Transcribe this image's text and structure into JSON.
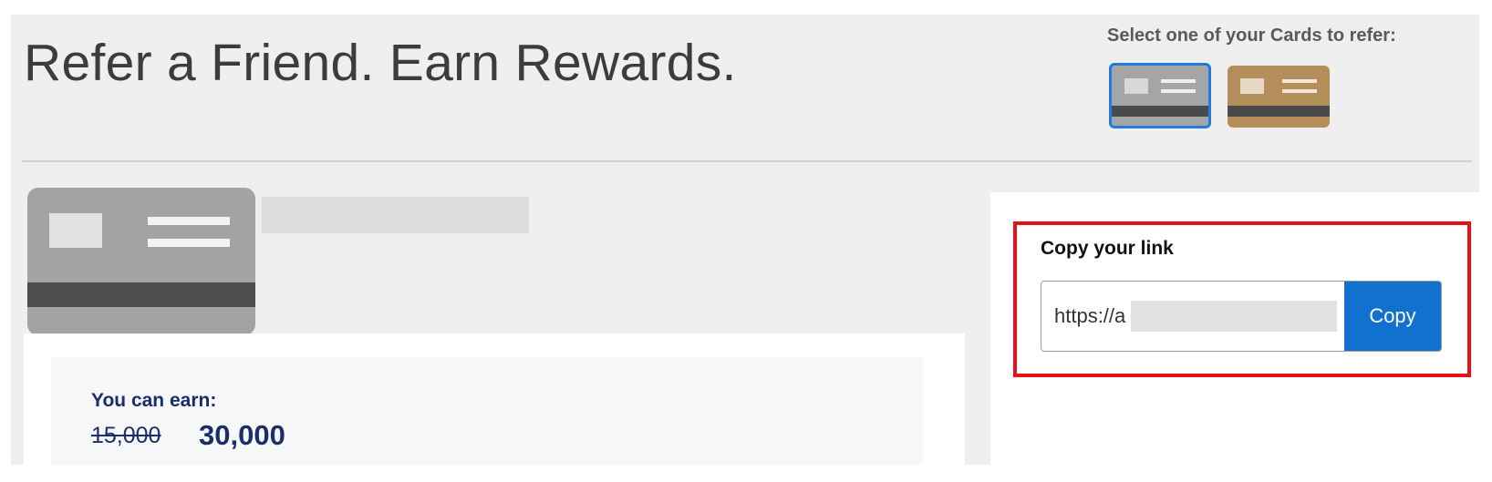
{
  "header": {
    "title": "Refer a Friend. Earn Rewards.",
    "select_label": "Select one of your Cards to refer:"
  },
  "cards": [
    {
      "name": "gray-card",
      "color": "#a5a5a7",
      "selected": true
    },
    {
      "name": "gold-card",
      "color": "#b48e5b",
      "selected": false
    }
  ],
  "offer": {
    "label": "You can earn:",
    "old_amount": "15,000",
    "new_amount": "30,000"
  },
  "referral": {
    "heading": "Copy your link",
    "link_value": "https://a",
    "copy_label": "Copy"
  },
  "colors": {
    "accent": "#1271cf",
    "highlight": "#e61016",
    "offer_text": "#1b2d6b"
  }
}
